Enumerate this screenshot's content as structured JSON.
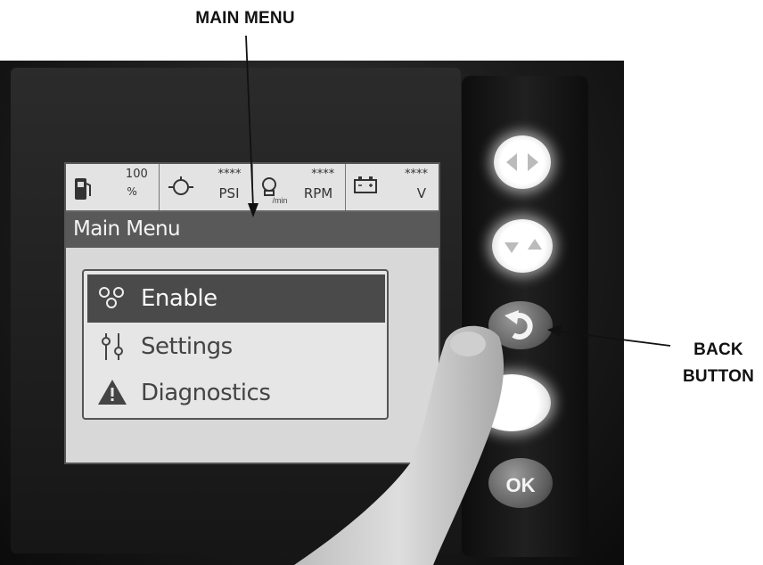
{
  "callouts": {
    "main_menu": "MAIN MENU",
    "back_line1": "BACK",
    "back_line2": "BUTTON"
  },
  "status_bar": {
    "fuel": {
      "value": "100",
      "unit": "%",
      "icon": "fuel-pump-icon"
    },
    "pressure": {
      "value": "****",
      "unit": "PSI",
      "icon": "oil-pressure-icon"
    },
    "speed": {
      "value": "****",
      "unit": "RPM",
      "sub_unit": "/min",
      "icon": "engine-icon"
    },
    "battery": {
      "value": "****",
      "unit": "V",
      "icon": "battery-icon"
    }
  },
  "screen": {
    "title": "Main Menu",
    "menu_items": [
      {
        "label": "Enable",
        "icon": "enable-icon",
        "selected": true
      },
      {
        "label": "Settings",
        "icon": "settings-sliders-icon",
        "selected": false
      },
      {
        "label": "Diagnostics",
        "icon": "warning-triangle-icon",
        "selected": false
      }
    ]
  },
  "buttons": {
    "up_down": "up-down-arrows-icon",
    "left_right": "left-right-arrows-icon",
    "back": "back-arrow-icon",
    "blank": "blank",
    "ok_label": "OK"
  },
  "colors": {
    "selected_row": "#4a4a4a",
    "title_bar": "#595959",
    "screen_bg": "#d8d8d8"
  }
}
